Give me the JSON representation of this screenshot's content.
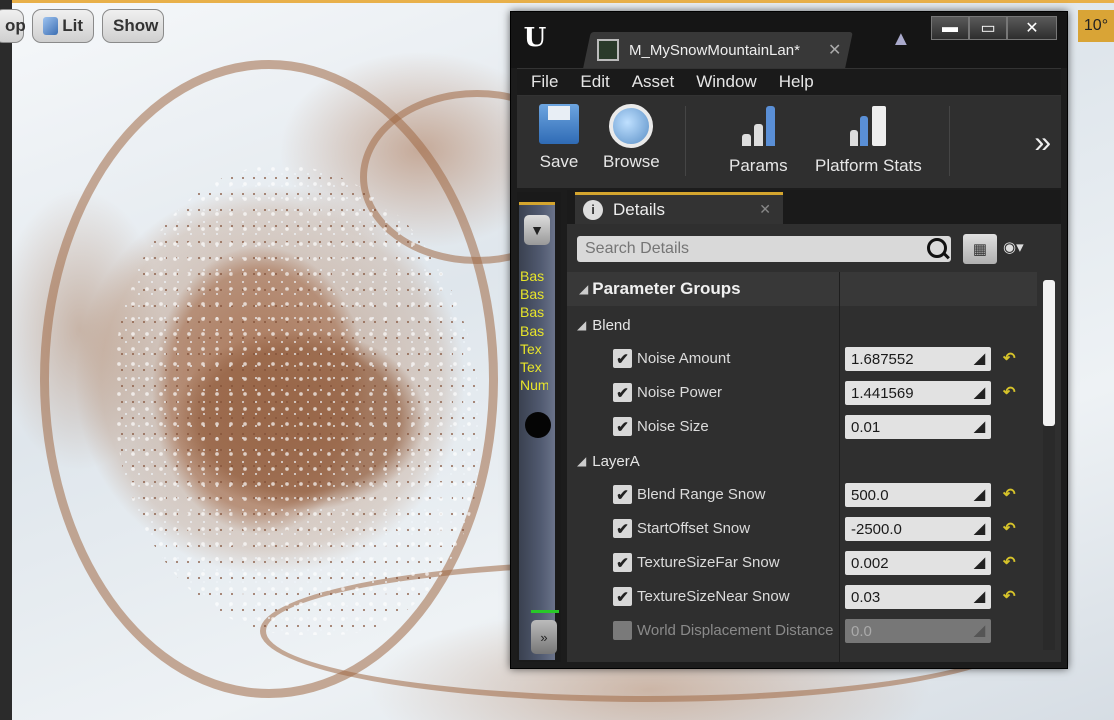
{
  "viewport": {
    "buttons": [
      {
        "label": "op"
      },
      {
        "label": "Lit"
      },
      {
        "label": "Show"
      }
    ],
    "right_badge": "10°"
  },
  "editor": {
    "tab_title": "M_MySnowMountainLan*",
    "menu": [
      "File",
      "Edit",
      "Asset",
      "Window",
      "Help"
    ],
    "toolbar": {
      "save_label": "Save",
      "browse_label": "Browse",
      "params_label": "Params",
      "platform_stats_label": "Platform Stats"
    },
    "side_labels": [
      "Bas",
      "Bas",
      "Bas",
      "Bas",
      "Tex",
      "Tex",
      "Num"
    ],
    "details": {
      "tab_label": "Details",
      "search_placeholder": "Search Details",
      "group_title": "Parameter Groups",
      "categories": [
        {
          "name": "Blend",
          "params": [
            {
              "name": "Noise Amount",
              "value": "1.687552",
              "checked": true,
              "resettable": true
            },
            {
              "name": "Noise Power",
              "value": "1.441569",
              "checked": true,
              "resettable": true
            },
            {
              "name": "Noise Size",
              "value": "0.01",
              "checked": true,
              "resettable": false
            }
          ]
        },
        {
          "name": "LayerA",
          "params": [
            {
              "name": "Blend Range Snow",
              "value": "500.0",
              "checked": true,
              "resettable": true
            },
            {
              "name": "StartOffset Snow",
              "value": "-2500.0",
              "checked": true,
              "resettable": true
            },
            {
              "name": "TextureSizeFar Snow",
              "value": "0.002",
              "checked": true,
              "resettable": true
            },
            {
              "name": "TextureSizeNear Snow",
              "value": "0.03",
              "checked": true,
              "resettable": true
            },
            {
              "name": "World Displacement Distance",
              "value": "0.0",
              "checked": false,
              "resettable": false
            }
          ]
        }
      ]
    }
  }
}
